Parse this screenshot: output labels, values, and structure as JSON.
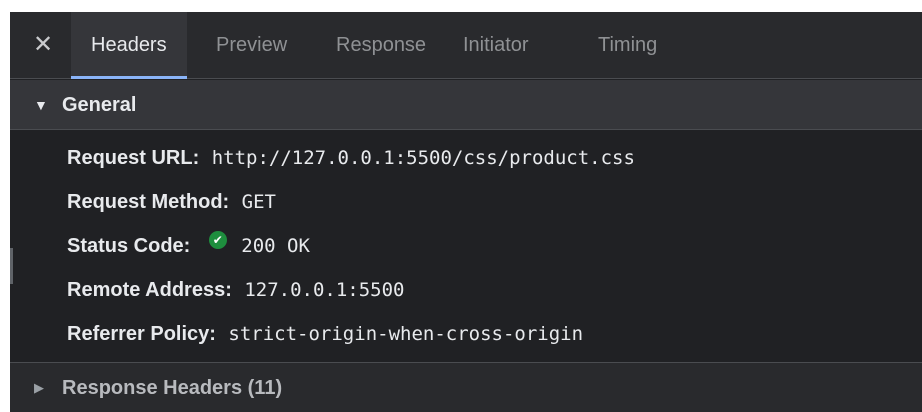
{
  "tabs": {
    "close_icon": "close-icon",
    "items": [
      "Headers",
      "Preview",
      "Response",
      "Initiator",
      "Timing"
    ],
    "active": "Headers"
  },
  "general": {
    "title": "General",
    "expanded": true,
    "rows": [
      {
        "key": "Request URL:",
        "value": "http://127.0.0.1:5500/css/product.css"
      },
      {
        "key": "Request Method:",
        "value": "GET"
      },
      {
        "key": "Status Code:",
        "value": "200 OK",
        "status_color": "#1e8e3e"
      },
      {
        "key": "Remote Address:",
        "value": "127.0.0.1:5500"
      },
      {
        "key": "Referrer Policy:",
        "value": "strict-origin-when-cross-origin"
      }
    ]
  },
  "response_headers": {
    "title": "Response Headers (11)",
    "expanded": false
  },
  "colors": {
    "background": "#202124",
    "accent": "#8ab4f8",
    "success": "#1e8e3e"
  }
}
